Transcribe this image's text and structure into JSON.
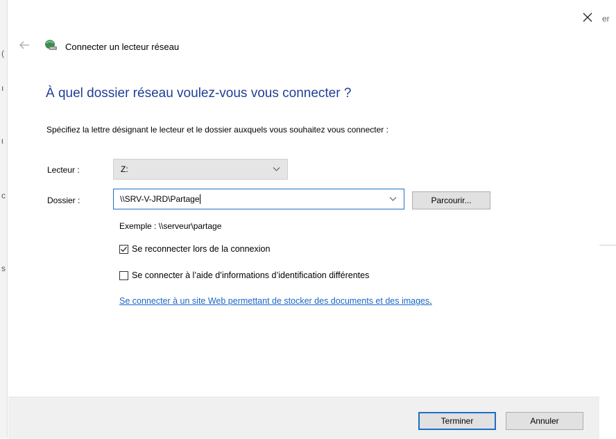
{
  "background": {
    "right_fragment": "er",
    "left_fragments": [
      "(",
      "ı",
      "ι",
      "c",
      "s"
    ]
  },
  "dialog": {
    "title": "Connecter un lecteur réseau",
    "heading": "À quel dossier réseau voulez-vous vous connecter ?",
    "instructions": "Spécifiez la lettre désignant le lecteur et le dossier auxquels vous souhaitez vous connecter :",
    "drive_label": "Lecteur :",
    "drive_value": "Z:",
    "folder_label": "Dossier :",
    "folder_value": "\\\\SRV-V-JRD\\Partage",
    "browse_label": "Parcourir...",
    "example": "Exemple : \\\\serveur\\partage",
    "reconnect_label": "Se reconnecter lors de la connexion",
    "reconnect_checked": true,
    "credentials_label": "Se connecter à l’aide d’informations d’identification différentes",
    "credentials_checked": false,
    "web_link": "Se connecter à un site Web permettant de stocker des documents et des images",
    "web_link_suffix": ".",
    "finish_label": "Terminer",
    "cancel_label": "Annuler"
  },
  "icons": {
    "close": "close-icon",
    "back": "back-arrow-icon",
    "network_drive": "network-drive-icon",
    "dropdown": "chevron-down-icon",
    "check": "checkmark-icon"
  },
  "colors": {
    "heading": "#1e3f94",
    "link": "#1a66c8",
    "focus_border": "#1d6dc4",
    "footer_bg": "#f0f0f0",
    "button_bg": "#e1e1e1"
  }
}
